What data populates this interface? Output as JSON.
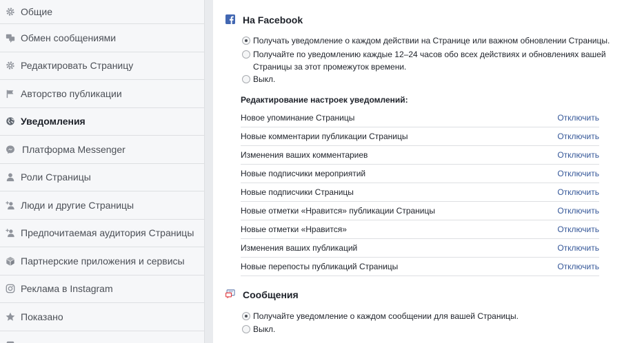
{
  "sidebar": {
    "items": [
      {
        "label": "Общие",
        "icon": "gear-icon"
      },
      {
        "label": "Обмен сообщениями",
        "icon": "chat-icon"
      },
      {
        "label": "Редактировать Страницу",
        "icon": "gear-icon"
      },
      {
        "label": "Авторство публикации",
        "icon": "flag-icon"
      },
      {
        "label": "Уведомления",
        "icon": "globe-icon",
        "active": true
      },
      {
        "label": "Платформа Messenger",
        "icon": "messenger-icon"
      },
      {
        "label": "Роли Страницы",
        "icon": "person-icon"
      },
      {
        "label": "Люди и другие Страницы",
        "icon": "person-add-icon"
      },
      {
        "label": "Предпочитаемая аудитория Страницы",
        "icon": "person-add-icon"
      },
      {
        "label": "Партнерские приложения и сервисы",
        "icon": "cube-icon"
      },
      {
        "label": "Реклама в Instagram",
        "icon": "instagram-icon"
      },
      {
        "label": "Показано",
        "icon": "star-icon"
      }
    ]
  },
  "facebook_section": {
    "title": "На Facebook",
    "options": [
      {
        "label": "Получать уведомление о каждом действии на Странице или важном обновлении Страницы.",
        "checked": true
      },
      {
        "label": "Получайте по уведомлению каждые 12–24 часов обо всех действиях и обновлениях вашей Страницы за этот промежуток времени.",
        "checked": false
      },
      {
        "label": "Выкл.",
        "checked": false
      }
    ],
    "settings_heading": "Редактирование настроек уведомлений:",
    "settings": [
      {
        "label": "Новое упоминание Страницы",
        "action": "Отключить"
      },
      {
        "label": "Новые комментарии публикации Страницы",
        "action": "Отключить"
      },
      {
        "label": "Изменения ваших комментариев",
        "action": "Отключить"
      },
      {
        "label": "Новые подписчики мероприятий",
        "action": "Отключить"
      },
      {
        "label": "Новые подписчики Страницы",
        "action": "Отключить"
      },
      {
        "label": "Новые отметки «Нравится» публикации Страницы",
        "action": "Отключить"
      },
      {
        "label": "Новые отметки «Нравится»",
        "action": "Отключить"
      },
      {
        "label": "Изменения ваших публикаций",
        "action": "Отключить"
      },
      {
        "label": "Новые перепосты публикаций Страницы",
        "action": "Отключить"
      }
    ]
  },
  "messages_section": {
    "title": "Сообщения",
    "options": [
      {
        "label": "Получайте уведомление о каждом сообщении для вашей Страницы.",
        "checked": true
      },
      {
        "label": "Выкл.",
        "checked": false
      }
    ]
  },
  "colors": {
    "link": "#365899",
    "facebook_blue": "#4267b2",
    "sidebar_bg": "#f6f7f9",
    "icon_gray": "#90949c"
  }
}
